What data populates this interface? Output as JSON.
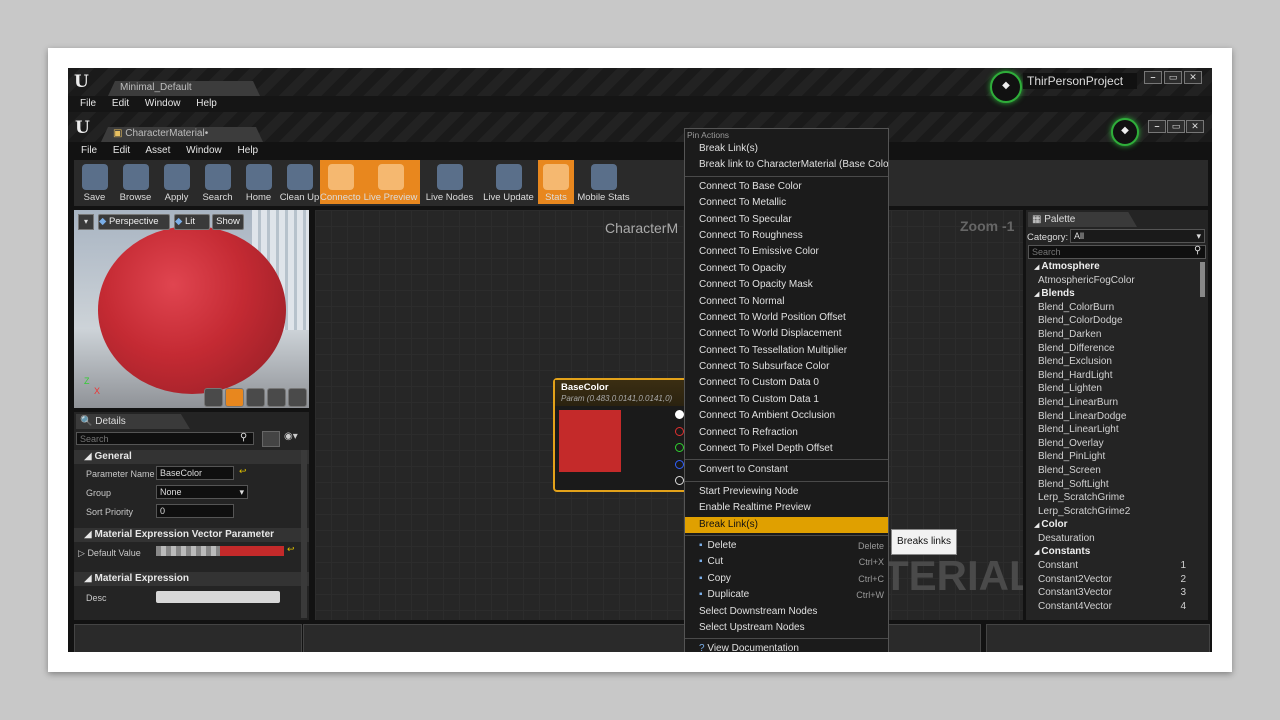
{
  "outer_window": {
    "tab_title": "Minimal_Default",
    "menu": [
      "File",
      "Edit",
      "Window",
      "Help"
    ],
    "project_name": "ThirPersonProject"
  },
  "editor_window": {
    "tab_title": "CharacterMaterial•",
    "menu": [
      "File",
      "Edit",
      "Asset",
      "Window",
      "Help"
    ]
  },
  "toolbar": [
    {
      "label": "Save",
      "icon": "save-icon",
      "active": false
    },
    {
      "label": "Browse",
      "icon": "browse-icon",
      "active": false
    },
    {
      "label": "Apply",
      "icon": "apply-check-icon",
      "active": false
    },
    {
      "label": "Search",
      "icon": "search-binoculars-icon",
      "active": false
    },
    {
      "label": "Home",
      "icon": "home-icon",
      "active": false
    },
    {
      "label": "Clean Up",
      "icon": "clean-up-broom-icon",
      "active": false
    },
    {
      "label": "Connectors",
      "icon": "connectors-icon",
      "active": true
    },
    {
      "label": "Live Preview",
      "icon": "live-preview-icon",
      "active": true
    },
    {
      "label": "Live Nodes",
      "icon": "live-nodes-icon",
      "active": false
    },
    {
      "label": "Live Update",
      "icon": "live-update-icon",
      "active": false
    },
    {
      "label": "Stats",
      "icon": "stats-icon",
      "active": true
    },
    {
      "label": "Mobile Stats",
      "icon": "mobile-stats-icon",
      "active": false
    }
  ],
  "viewport": {
    "perspective_label": "Perspective",
    "lit_label": "Lit",
    "show_label": "Show",
    "preview_color": "#c42a33",
    "axis_x": "X",
    "axis_z": "Z"
  },
  "details": {
    "tab_label": "Details",
    "search_placeholder": "Search",
    "general_header": "General",
    "param_name_label": "Parameter Name",
    "param_name_value": "BaseColor",
    "group_label": "Group",
    "group_value": "None",
    "sort_priority_label": "Sort Priority",
    "sort_priority_value": "0",
    "vector_header": "Material Expression Vector Parameter",
    "default_value_label": "Default Value",
    "default_value_color": "#c42a2a",
    "expression_header": "Material Expression",
    "desc_label": "Desc"
  },
  "graph": {
    "title": "CharacterM",
    "zoom": "Zoom -1",
    "watermark": "TERIAL",
    "node": {
      "title": "BaseColor",
      "subtitle": "Param (0.483,0.0141,0.0141,0)",
      "color": "#c42a2a",
      "pin_colors": [
        "#ffffff",
        "#e03030",
        "#30d030",
        "#3060ff",
        "#dddddd"
      ]
    }
  },
  "context_menu": {
    "header": "Pin Actions",
    "group1": [
      "Break Link(s)",
      "Break link to CharacterMaterial (Base Color)"
    ],
    "connect": [
      "Connect To Base Color",
      "Connect To Metallic",
      "Connect To Specular",
      "Connect To Roughness",
      "Connect To Emissive Color",
      "Connect To Opacity",
      "Connect To Opacity Mask",
      "Connect To Normal",
      "Connect To World Position Offset",
      "Connect To World Displacement",
      "Connect To Tessellation Multiplier",
      "Connect To Subsurface Color",
      "Connect To Custom Data 0",
      "Connect To Custom Data 1",
      "Connect To Ambient Occlusion",
      "Connect To Refraction",
      "Connect To Pixel Depth Offset"
    ],
    "convert": "Convert to Constant",
    "preview_group": [
      "Start Previewing Node",
      "Enable Realtime Preview"
    ],
    "highlighted": "Break Link(s)",
    "edit_group": [
      {
        "label": "Delete",
        "shortcut": "Delete",
        "icon": "delete-icon"
      },
      {
        "label": "Cut",
        "shortcut": "Ctrl+X",
        "icon": "cut-icon"
      },
      {
        "label": "Copy",
        "shortcut": "Ctrl+C",
        "icon": "copy-icon"
      },
      {
        "label": "Duplicate",
        "shortcut": "Ctrl+W",
        "icon": "duplicate-icon"
      }
    ],
    "select_group": [
      "Select Downstream Nodes",
      "Select Upstream Nodes"
    ],
    "documentation": "View Documentation",
    "tooltip": "Breaks links"
  },
  "palette": {
    "tab_label": "Palette",
    "category_label": "Category:",
    "category_value": "All",
    "search_placeholder": "Search",
    "items": [
      {
        "label": "Atmosphere",
        "cat": true
      },
      {
        "label": "AtmosphericFogColor"
      },
      {
        "label": "Blends",
        "cat": true
      },
      {
        "label": "Blend_ColorBurn"
      },
      {
        "label": "Blend_ColorDodge"
      },
      {
        "label": "Blend_Darken"
      },
      {
        "label": "Blend_Difference"
      },
      {
        "label": "Blend_Exclusion"
      },
      {
        "label": "Blend_HardLight"
      },
      {
        "label": "Blend_Lighten"
      },
      {
        "label": "Blend_LinearBurn"
      },
      {
        "label": "Blend_LinearDodge"
      },
      {
        "label": "Blend_LinearLight"
      },
      {
        "label": "Blend_Overlay"
      },
      {
        "label": "Blend_PinLight"
      },
      {
        "label": "Blend_Screen"
      },
      {
        "label": "Blend_SoftLight"
      },
      {
        "label": "Lerp_ScratchGrime"
      },
      {
        "label": "Lerp_ScratchGrime2"
      },
      {
        "label": "Color",
        "cat": true
      },
      {
        "label": "Desaturation"
      },
      {
        "label": "Constants",
        "cat": true
      },
      {
        "label": "Constant",
        "n": "1"
      },
      {
        "label": "Constant2Vector",
        "n": "2"
      },
      {
        "label": "Constant3Vector",
        "n": "3"
      },
      {
        "label": "Constant4Vector",
        "n": "4"
      }
    ]
  },
  "colors": {
    "accent_orange": "#e8871e",
    "highlight_yellow": "#e0a000",
    "node_border": "#e3a21a"
  }
}
